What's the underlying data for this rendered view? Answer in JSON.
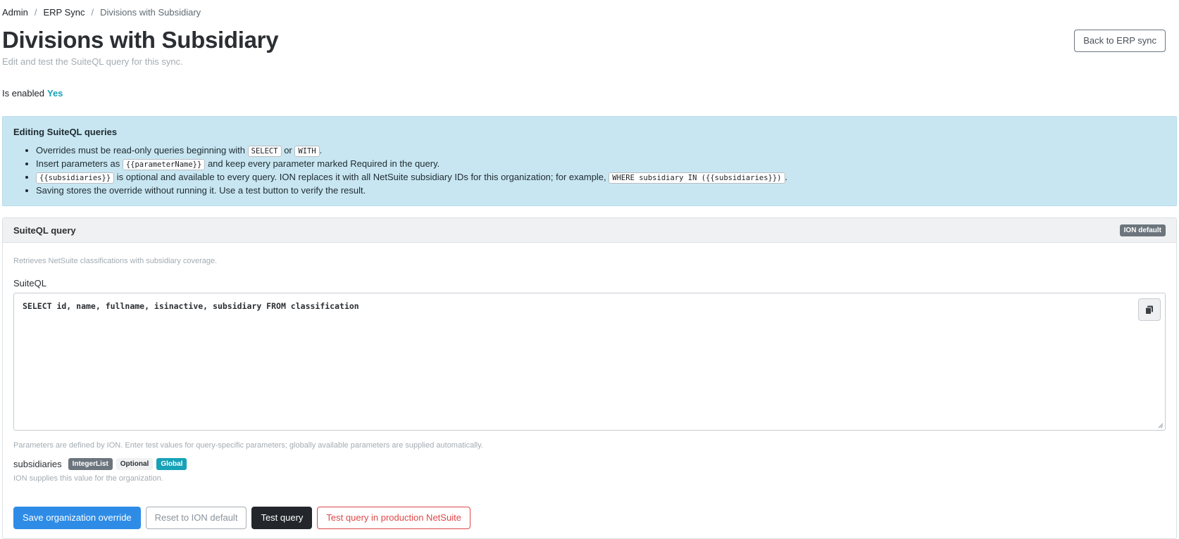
{
  "breadcrumb": [
    "Admin",
    "ERP Sync",
    "Divisions with Subsidiary"
  ],
  "page": {
    "title": "Divisions with Subsidiary",
    "subtitle": "Edit and test the SuiteQL query for this sync.",
    "back_button": "Back to ERP sync",
    "enabled_label": "Is enabled",
    "enabled_value": "Yes"
  },
  "info": {
    "title": "Editing SuiteQL queries",
    "items": {
      "1": {
        "before": "Overrides must be read-only queries beginning with",
        "code1": "SELECT",
        "mid": "or",
        "code2": "WITH",
        "after": "."
      },
      "2": {
        "before": "Insert parameters as",
        "code": "{{parameterName}}",
        "after": "and keep every parameter marked Required in the query."
      },
      "3": {
        "code": "{{subsidiaries}}",
        "mid": "is optional and available to every query. ION replaces it with all NetSuite subsidiary IDs for this organization; for example,",
        "code2": "WHERE subsidiary IN ({{subsidiaries}})",
        "after": "."
      },
      "4": {
        "text": "Saving stores the override without running it. Use a test button to verify the result."
      }
    }
  },
  "query_card": {
    "title": "SuiteQL query",
    "badge": "ION default",
    "description": "Retrieves NetSuite classifications with subsidiary coverage.",
    "field_label": "SuiteQL",
    "query": "SELECT id, name, fullname, isinactive, subsidiary FROM classification",
    "params_note": "Parameters are defined by ION. Enter test values for query-specific parameters; globally available parameters are supplied automatically.",
    "param": {
      "name": "subsidiaries",
      "type": "IntegerList",
      "required": "Optional",
      "scope": "Global",
      "help": "ION supplies this value for the organization."
    },
    "actions": {
      "save": "Save organization override",
      "reset": "Reset to ION default",
      "test": "Test query",
      "test_prod": "Test query in production NetSuite"
    }
  },
  "colors": {
    "primary": "#2e8ce6",
    "info_bg": "#c8e6f1",
    "teal": "#17a2b8",
    "danger": "#e04848",
    "dark": "#23272b"
  },
  "icons": {
    "copy": "copy-icon"
  }
}
